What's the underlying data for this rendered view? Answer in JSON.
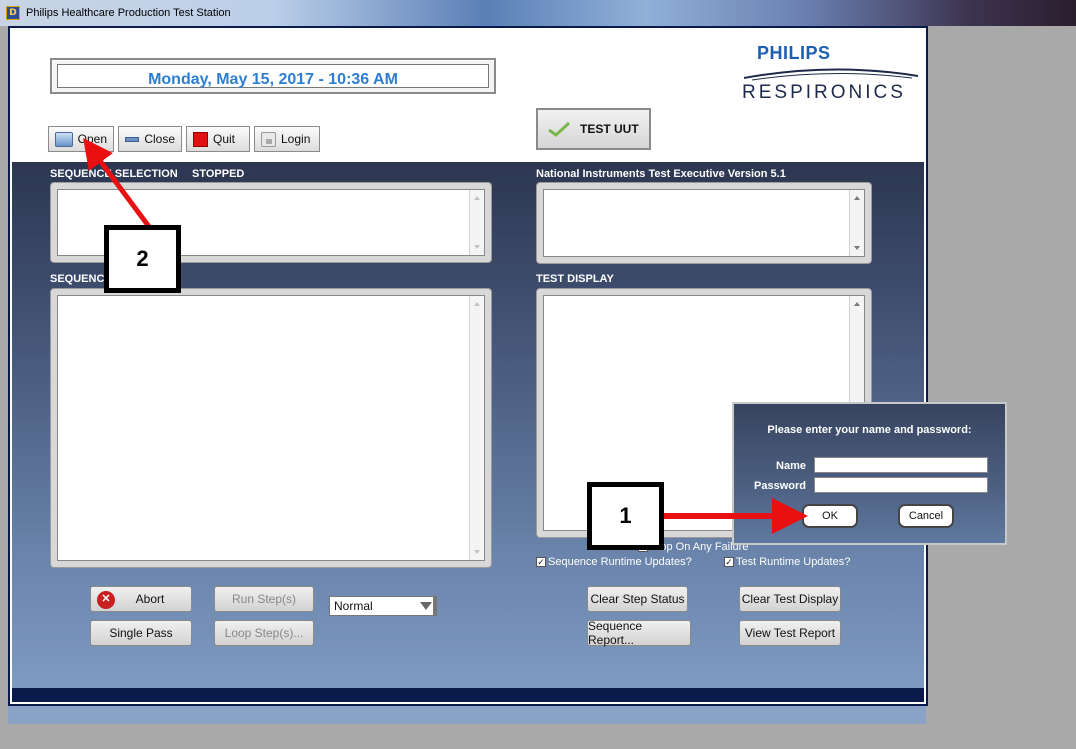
{
  "window": {
    "title": "Philips Healthcare Production Test Station",
    "icon": "app-icon"
  },
  "header": {
    "datetime": "Monday, May 15, 2017 - 10:36 AM",
    "logo_line1": "PHILIPS",
    "logo_line2": "RESPIRONICS"
  },
  "toolbar": {
    "open_label": "Open",
    "close_label": "Close",
    "quit_label": "Quit",
    "login_label": "Login",
    "test_uut_label": "TEST UUT"
  },
  "panels": {
    "sequence_selection_label": "SEQUENCE SELECTION",
    "status_label": "STOPPED",
    "sequence_label": "SEQUENCE",
    "executive_label": "National Instruments Test Executive Version 5.1",
    "test_display_label": "TEST DISPLAY"
  },
  "options": {
    "stop_on_failure": "Stop On Any Failure",
    "stop_on_failure_checked": false,
    "seq_runtime_updates": "Sequence Runtime Updates?",
    "seq_runtime_updates_checked": true,
    "test_runtime_updates": "Test Runtime Updates?",
    "test_runtime_updates_checked": true
  },
  "controls": {
    "abort": "Abort",
    "single_pass": "Single Pass",
    "run_steps": "Run Step(s)",
    "loop_steps": "Loop Step(s)...",
    "mode_value": "Normal",
    "clear_step_status": "Clear Step Status",
    "clear_test_display": "Clear Test Display",
    "sequence_report": "Sequence Report...",
    "view_test_report": "View Test Report"
  },
  "login_dialog": {
    "prompt": "Please enter your name and password:",
    "name_label": "Name",
    "password_label": "Password",
    "name_value": "",
    "password_value": "",
    "ok": "OK",
    "cancel": "Cancel"
  },
  "annotations": {
    "callout_1": "1",
    "callout_2": "2",
    "arrow_color": "#e81010"
  },
  "colors": {
    "date_text": "#2e7ed0",
    "brand_blue": "#1b5fb4",
    "frame": "#0a1a4a"
  }
}
